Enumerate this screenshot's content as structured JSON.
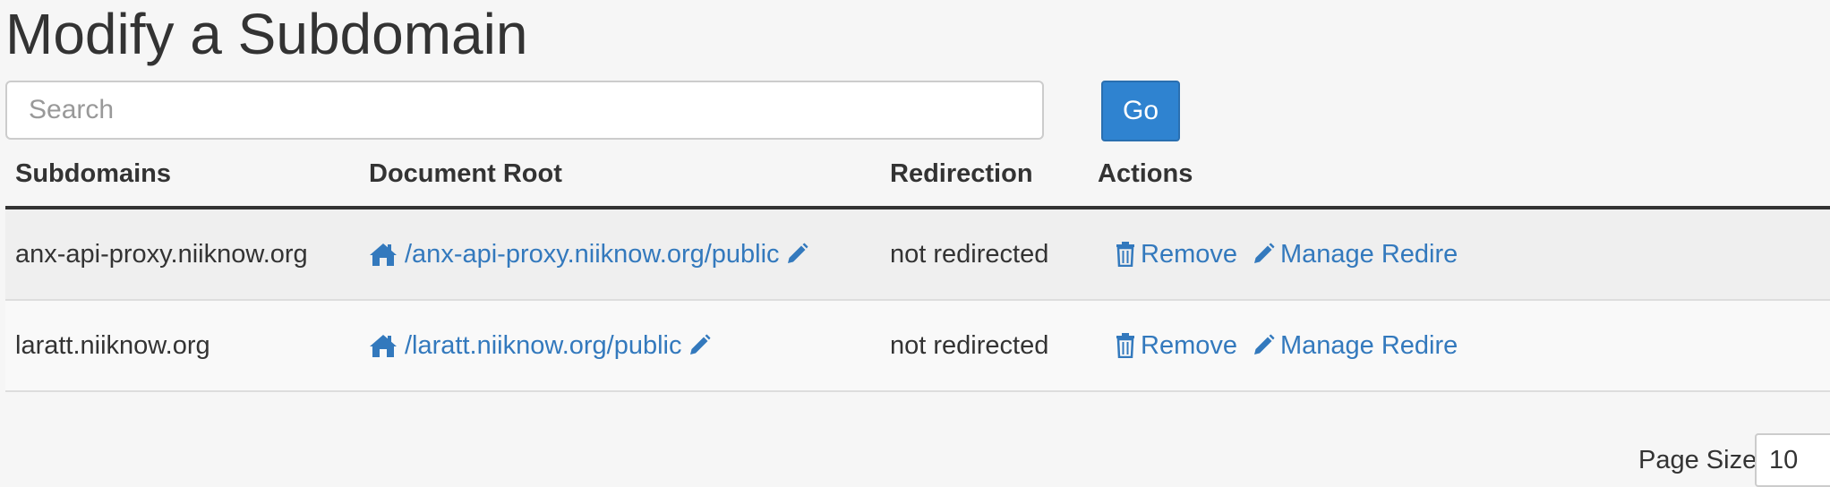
{
  "page": {
    "title": "Modify a Subdomain"
  },
  "search": {
    "placeholder": "Search",
    "value": "",
    "go_label": "Go"
  },
  "table": {
    "headers": {
      "subdomains": "Subdomains",
      "document_root": "Document Root",
      "redirection": "Redirection",
      "actions": "Actions"
    },
    "rows": [
      {
        "subdomain": "anx-api-proxy.niiknow.org",
        "document_root": "/anx-api-proxy.niiknow.org/public",
        "redirection": "not redirected",
        "remove_label": "Remove",
        "manage_label": "Manage Redire"
      },
      {
        "subdomain": "laratt.niiknow.org",
        "document_root": "/laratt.niiknow.org/public",
        "redirection": "not redirected",
        "remove_label": "Remove",
        "manage_label": "Manage Redire"
      }
    ]
  },
  "pagination": {
    "page_size_label": "Page Size",
    "page_size_value": "10"
  },
  "colors": {
    "link": "#3379bd",
    "primary_button": "#2f83d0",
    "background": "#f6f6f6"
  },
  "icons": {
    "home": "home-icon",
    "edit": "pencil-icon",
    "remove": "trash-icon",
    "manage": "pencil-icon"
  }
}
